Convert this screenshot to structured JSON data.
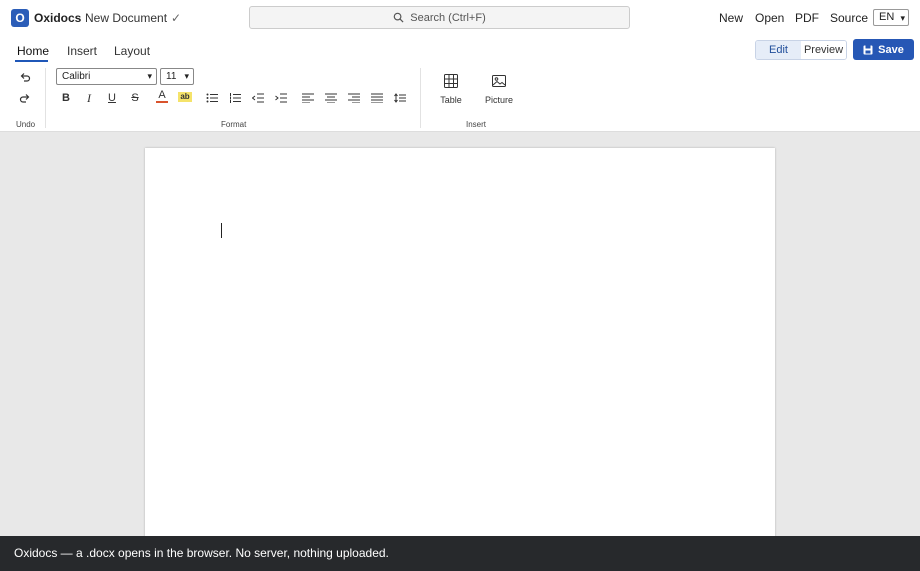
{
  "app": {
    "logo_letter": "O",
    "name": "Oxidocs",
    "document_title": "New Document",
    "saved_mark": "✓"
  },
  "search": {
    "placeholder": "Search (Ctrl+F)"
  },
  "topnav": {
    "new": "New",
    "open": "Open",
    "pdf": "PDF",
    "source": "Source",
    "language": "EN"
  },
  "tabs": [
    {
      "label": "Home"
    },
    {
      "label": "Insert"
    },
    {
      "label": "Layout"
    }
  ],
  "modes": {
    "edit": "Edit",
    "preview": "Preview"
  },
  "save_label": "Save",
  "format": {
    "font": "Calibri",
    "size": "11",
    "highlight_glyph": "ab"
  },
  "insert": {
    "table": "Table",
    "picture": "Picture"
  },
  "groups": {
    "undo": "Undo",
    "format": "Format",
    "insert": "Insert"
  },
  "banner": {
    "message": "Oxidocs — a .docx opens in the browser. No server, nothing uploaded."
  },
  "colors": {
    "accent": "#2657b5",
    "font_color_bar": "#d9532c",
    "highlight": "#f5e36a"
  }
}
